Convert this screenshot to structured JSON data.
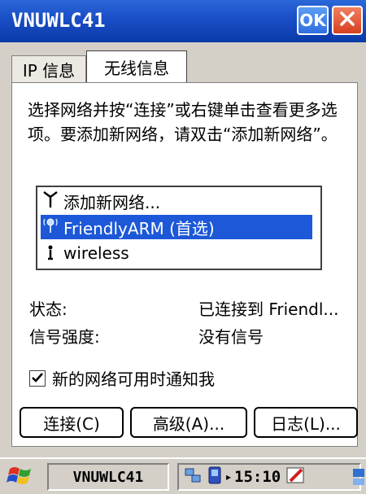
{
  "window": {
    "title": "VNUWLC41",
    "ok_label": "OK"
  },
  "tabs": [
    {
      "label": "IP 信息"
    },
    {
      "label": "无线信息"
    }
  ],
  "instructions": "选择网络并按“连接”或右键单击查看更多选项。要添加新网络，请双击“添加新网络”。",
  "networks": [
    {
      "icon": "antenna-icon",
      "label": "添加新网络..."
    },
    {
      "icon": "wifi-signal-icon",
      "label": "FriendlyARM (首选)",
      "selected": true
    },
    {
      "icon": "wireless-tower-icon",
      "label": "wireless"
    }
  ],
  "status": {
    "state_label": "状态:",
    "state_value": "已连接到 Friendl...",
    "signal_label": "信号强度:",
    "signal_value": "没有信号"
  },
  "notify": {
    "label": "新的网络可用时通知我",
    "checked": true
  },
  "buttons": {
    "connect": "连接(C)",
    "advanced": "高级(A)...",
    "log": "日志(L)..."
  },
  "taskbar": {
    "task_label": "VNUWLC41",
    "time": "15:10"
  },
  "colors": {
    "title_blue": "#1c50c8",
    "selection_blue": "#1c58d8",
    "close_red": "#d84020"
  }
}
